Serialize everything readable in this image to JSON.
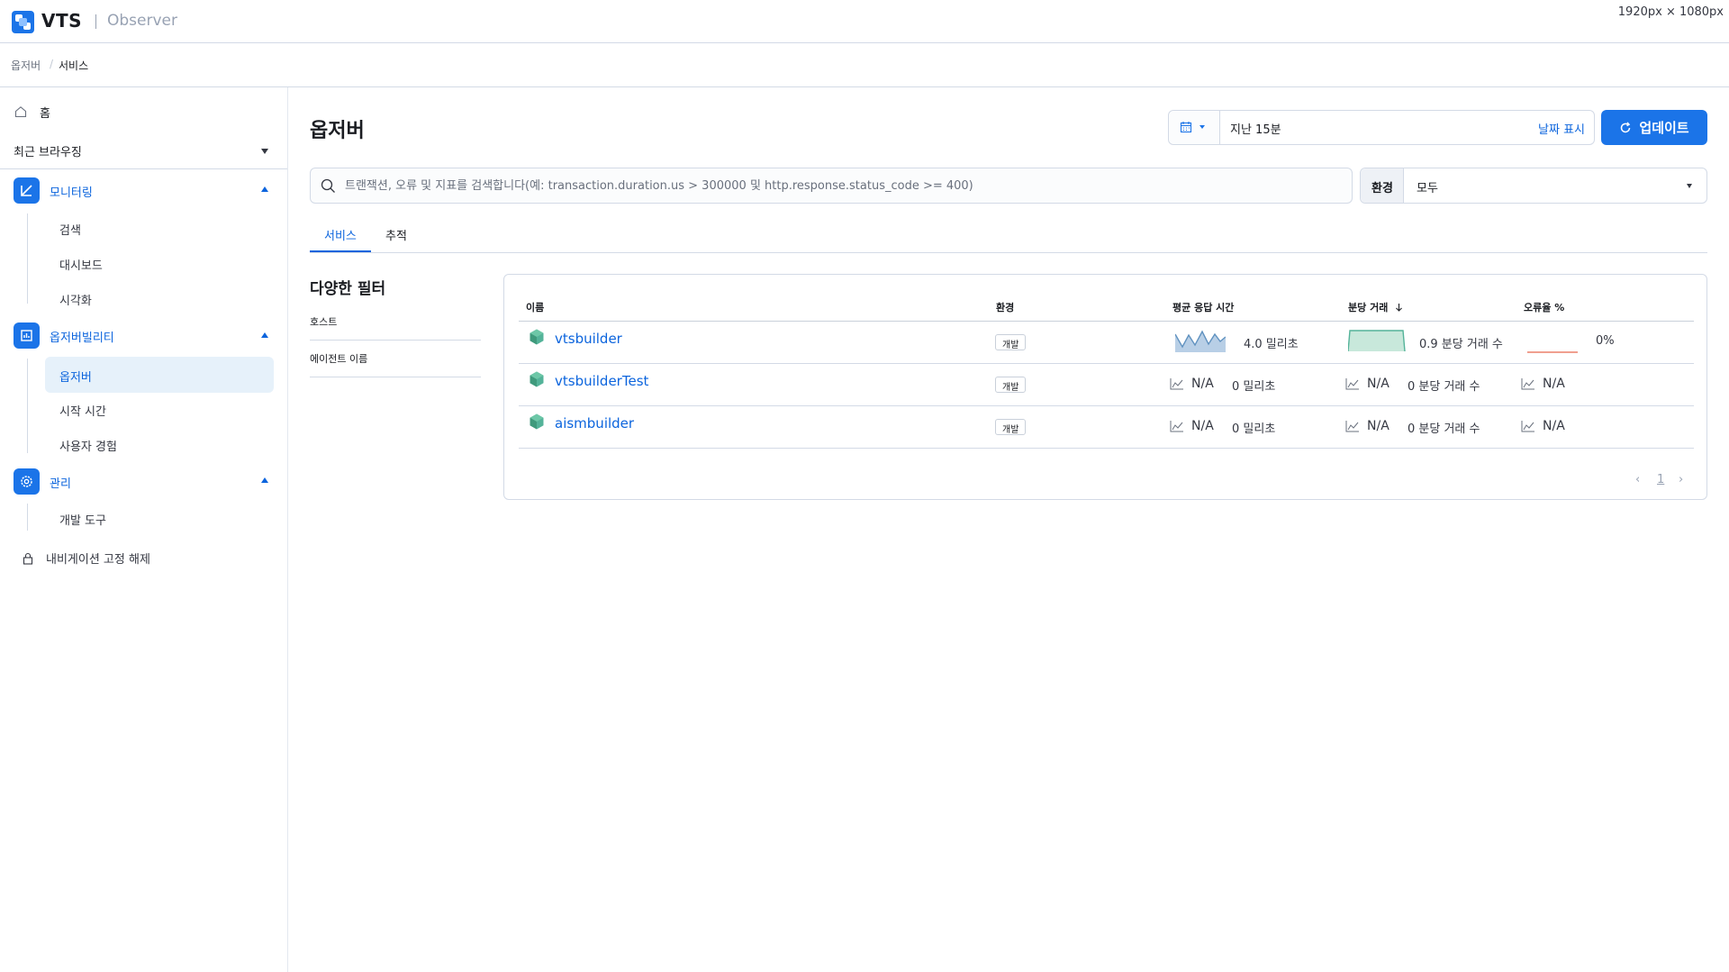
{
  "app": {
    "logo_text": "VTS",
    "product": "Observer",
    "screen_size_label": "1920px × 1080px"
  },
  "breadcrumbs": [
    "옵저버",
    "서비스"
  ],
  "sidebar": {
    "home": "홈",
    "recent": "최근 브라우징",
    "groups": [
      {
        "label": "모니터링",
        "icon": "monitoring-icon",
        "items": [
          "검색",
          "대시보드",
          "시각화"
        ]
      },
      {
        "label": "옵저버빌리티",
        "icon": "observability-icon",
        "items": [
          "옵저버",
          "시작 시간",
          "사용자 경험"
        ],
        "active_item": "옵저버"
      },
      {
        "label": "관리",
        "icon": "gear-icon",
        "items": [
          "개발 도구"
        ]
      }
    ],
    "unpin": "내비게이션 고정 해제"
  },
  "page": {
    "title": "옵저버",
    "date": {
      "value": "지난 15분",
      "show_dates": "날짜 표시"
    },
    "update_button": "업데이트",
    "search": {
      "placeholder": "트랜잭션, 오류 및 지표를 검색합니다(예: transaction.duration.us > 300000 및 http.response.status_code >= 400)"
    },
    "environment": {
      "label": "환경",
      "value": "모두"
    },
    "tabs": [
      "서비스",
      "추적"
    ],
    "active_tab": "서비스"
  },
  "filters": {
    "title": "다양한 필터",
    "items": [
      "호스트",
      "에이전트 이름"
    ]
  },
  "table": {
    "headers": {
      "name": "이름",
      "environment": "환경",
      "latency": "평균 응답 시간",
      "throughput": "분당 거래",
      "error_rate": "오류율 %"
    },
    "sorted_by": "throughput",
    "sort_direction": "descending",
    "rows": [
      {
        "name": "vtsbuilder",
        "environment": "개발",
        "latency": "4.0 밀리초",
        "throughput": "0.9 분당 거래 수",
        "error_rate": "0%",
        "has_sparkline": true
      },
      {
        "name": "vtsbuilderTest",
        "environment": "개발",
        "latency_na": "N/A",
        "latency": "0 밀리초",
        "throughput_na": "N/A",
        "throughput": "0 분당 거래 수",
        "error_rate": "N/A",
        "has_sparkline": false
      },
      {
        "name": "aismbuilder",
        "environment": "개발",
        "latency_na": "N/A",
        "latency": "0 밀리초",
        "throughput_na": "N/A",
        "throughput": "0 분당 거래 수",
        "error_rate": "N/A",
        "has_sparkline": false
      }
    ],
    "pagination": {
      "current_page": "1"
    }
  },
  "colors": {
    "primary": "#1b74e8",
    "link": "#0b64dd",
    "service_icon": "#54b399",
    "latency_spark": "#6092c0",
    "throughput_spark": "#54b399",
    "error_spark": "#e7664c"
  }
}
